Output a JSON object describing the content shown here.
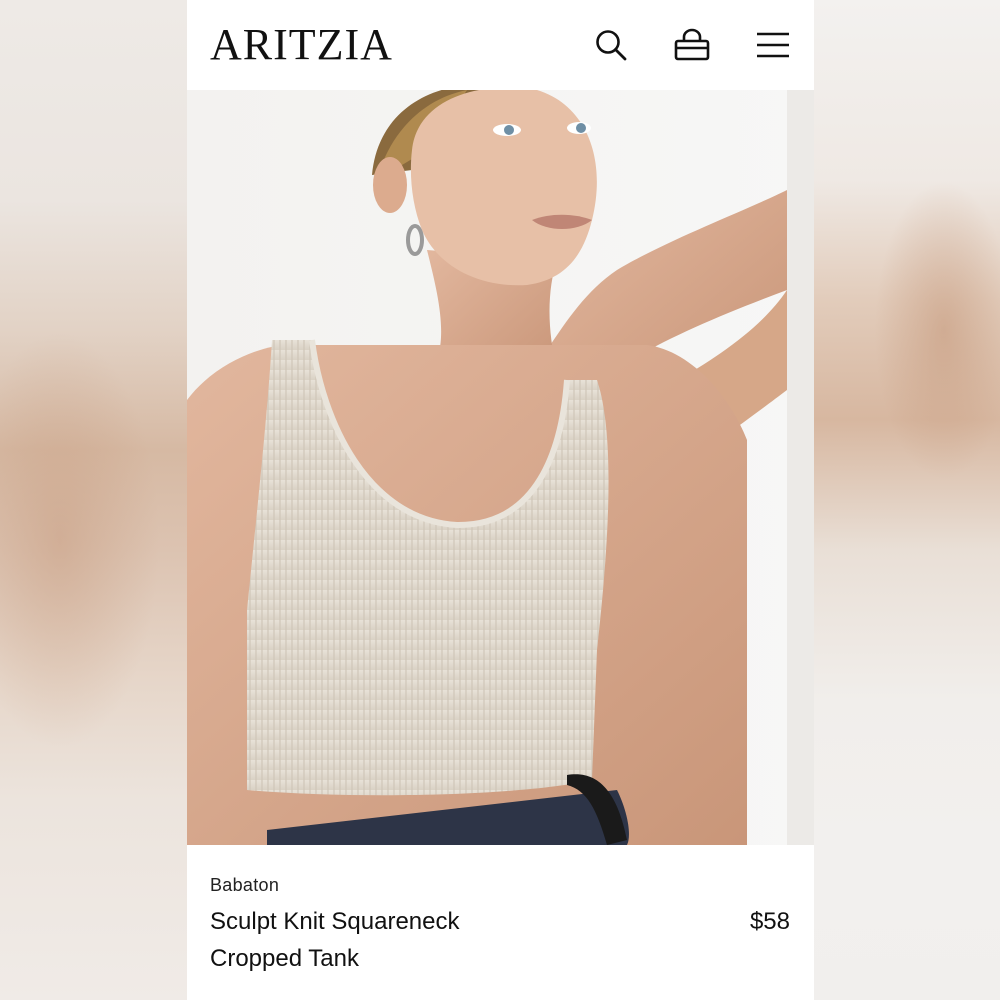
{
  "header": {
    "logo": "ARITZIA",
    "icons": [
      "search-icon",
      "shopping-bag-icon",
      "menu-icon"
    ]
  },
  "product": {
    "brand": "Babaton",
    "name": "Sculpt Knit Squareneck Cropped Tank",
    "price": "$58"
  },
  "colors": {
    "text": "#111111",
    "background": "#ffffff",
    "garment": "#e2dbcf",
    "skin": "#dcb096"
  }
}
